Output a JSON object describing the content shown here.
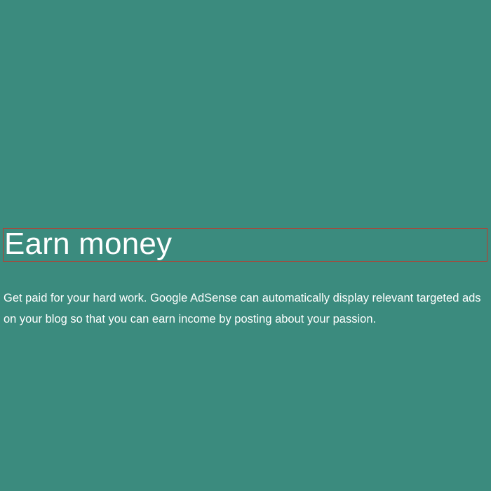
{
  "section": {
    "title": "Earn money",
    "description": "Get paid for your hard work. Google AdSense can automatically display relevant targeted ads on your blog so that you can earn income by posting about your passion."
  },
  "colors": {
    "background": "#3b8b7e",
    "text": "#ffffff",
    "highlight_border": "#c0392b"
  }
}
